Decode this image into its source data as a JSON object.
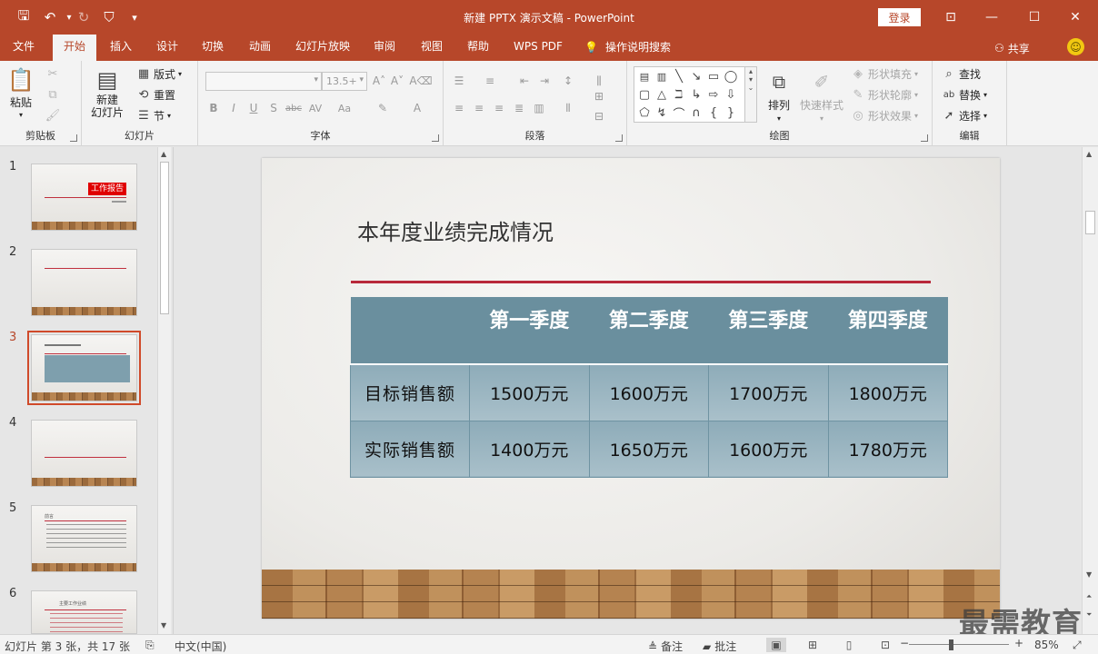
{
  "window": {
    "title": "新建 PPTX 演示文稿  -  PowerPoint",
    "login_label": "登录"
  },
  "tabs": [
    "文件",
    "开始",
    "插入",
    "设计",
    "切换",
    "动画",
    "幻灯片放映",
    "审阅",
    "视图",
    "帮助",
    "WPS PDF"
  ],
  "active_tab": "开始",
  "tell_me": "操作说明搜索",
  "share_label": "共享",
  "ribbon": {
    "clipboard": {
      "label": "剪贴板",
      "paste": "粘贴"
    },
    "slides": {
      "label": "幻灯片",
      "new_slide_line1": "新建",
      "new_slide_line2": "幻灯片",
      "layout": "版式",
      "reset": "重置",
      "section": "节"
    },
    "font": {
      "label": "字体",
      "font_name": "",
      "font_size": "13.5+"
    },
    "paragraph": {
      "label": "段落"
    },
    "drawing": {
      "label": "绘图",
      "arrange": "排列",
      "quick_styles": "快速样式",
      "shape_fill": "形状填充",
      "shape_outline": "形状轮廓",
      "shape_effects": "形状效果"
    },
    "editing": {
      "label": "编辑",
      "find": "查找",
      "replace": "替换",
      "select": "选择"
    }
  },
  "thumbnails": [
    {
      "number": "1",
      "title": "工作报告"
    },
    {
      "number": "2"
    },
    {
      "number": "3",
      "active": true
    },
    {
      "number": "4"
    },
    {
      "number": "5",
      "title": "前言"
    },
    {
      "number": "6",
      "title": "主要工作业绩"
    }
  ],
  "slide": {
    "title": "本年度业绩完成情况",
    "table": {
      "headers": [
        "",
        "第一季度",
        "第二季度",
        "第三季度",
        "第四季度"
      ],
      "rows": [
        [
          "目标销售额",
          "1500万元",
          "1600万元",
          "1700万元",
          "1800万元"
        ],
        [
          "实际销售额",
          "1400万元",
          "1650万元",
          "1600万元",
          "1780万元"
        ]
      ]
    }
  },
  "watermark": "最需教育",
  "status": {
    "slide_info": "幻灯片 第 3 张，共 17 张",
    "language": "中文(中国)",
    "notes": "备注",
    "comments": "批注",
    "zoom_value": 85,
    "zoom": "85%"
  },
  "colors": {
    "accent": "#b7472a",
    "table_header": "#6a8f9e",
    "table_body": "#9db7c2",
    "title_rule": "#b8283a"
  }
}
